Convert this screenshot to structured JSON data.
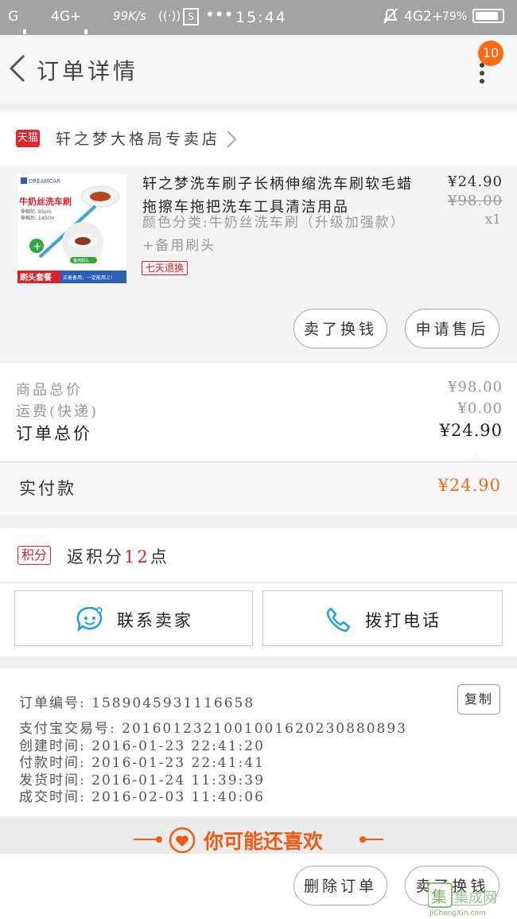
{
  "status_bar": {
    "carrier": "G",
    "network": "4G+",
    "speed": "99K/s",
    "time": "15:44",
    "network2": "4G2+",
    "battery": "79%"
  },
  "header": {
    "title": "订单详情",
    "badge_count": "10"
  },
  "store": {
    "badge": "天猫",
    "name": "轩之梦大格局专卖店"
  },
  "product": {
    "title": "轩之梦洗车刷子长柄伸缩洗车刷软毛蜡拖擦车拖把洗车工具清洁用品",
    "sku": "颜色分类:牛奶丝洗车刷（升级加强款）+备用刷头",
    "tag": "七天退换",
    "price": "¥24.90",
    "original_price": "¥98.00",
    "quantity": "x1",
    "thumb": {
      "brand": "DREAMCAR",
      "headline": "牛奶丝洗车刷",
      "spec1": "伸缩前: 95cm",
      "spec2": "伸缩后: 145cm",
      "spare": "备用刷头",
      "bottom_tag": "刷头套餐",
      "bottom_text": "买着备用，一定能用上!"
    },
    "buttons": {
      "refund": "卖了换钱",
      "after_sale": "申请售后"
    }
  },
  "totals": {
    "goods_label": "商品总价",
    "goods_value": "¥98.00",
    "shipping_label": "运费(快递)",
    "shipping_value": "¥0.00",
    "order_label": "订单总价",
    "order_value": "¥24.90",
    "paid_label": "实付款",
    "paid_value": "¥24.90"
  },
  "points": {
    "tag": "积分",
    "prefix": "返积分",
    "value": "12",
    "suffix": "点"
  },
  "contact": {
    "seller": "联系卖家",
    "phone": "拨打电话"
  },
  "order_info": {
    "order_no": "订单编号: 1589045931116658",
    "alipay_no": "支付宝交易号: 2016012321001001620230880893",
    "created": "创建时间: 2016-01-23 22:41:20",
    "paid": "付款时间: 2016-01-23 22:41:41",
    "shipped": "发货时间: 2016-01-24 11:39:39",
    "completed": "成交时间: 2016-02-03 11:40:06",
    "copy": "复制"
  },
  "recommend": {
    "title": "你可能还喜欢"
  },
  "bottom": {
    "delete": "删除订单",
    "sell": "卖了换钱"
  },
  "watermark": {
    "text": "集成网",
    "url": "JiChengXin.com"
  },
  "colors": {
    "accent": "#ff6a12",
    "price_orange": "#f26b1d",
    "tmall_red": "#e5252b",
    "contact_blue": "#1aa0e8"
  }
}
